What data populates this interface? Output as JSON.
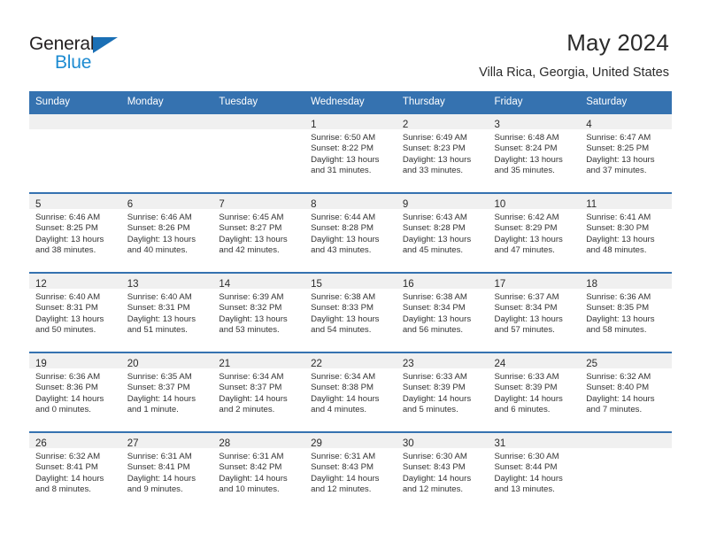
{
  "brand": {
    "name_top": "General",
    "name_bottom": "Blue",
    "triangle_color": "#1a6fb5",
    "blue_text_color": "#1d8bd1"
  },
  "header": {
    "title": "May 2024",
    "subtitle": "Villa Rica, Georgia, United States",
    "header_bg_color": "#3572b0",
    "header_text_color": "#ffffff",
    "daynum_strip_color": "#f0f0f0"
  },
  "weekday_headers": [
    "Sunday",
    "Monday",
    "Tuesday",
    "Wednesday",
    "Thursday",
    "Friday",
    "Saturday"
  ],
  "weeks": [
    [
      {
        "day": "",
        "sunrise": "",
        "sunset": "",
        "daylight_line1": "",
        "daylight_line2": ""
      },
      {
        "day": "",
        "sunrise": "",
        "sunset": "",
        "daylight_line1": "",
        "daylight_line2": ""
      },
      {
        "day": "",
        "sunrise": "",
        "sunset": "",
        "daylight_line1": "",
        "daylight_line2": ""
      },
      {
        "day": "1",
        "sunrise": "Sunrise: 6:50 AM",
        "sunset": "Sunset: 8:22 PM",
        "daylight_line1": "Daylight: 13 hours",
        "daylight_line2": "and 31 minutes."
      },
      {
        "day": "2",
        "sunrise": "Sunrise: 6:49 AM",
        "sunset": "Sunset: 8:23 PM",
        "daylight_line1": "Daylight: 13 hours",
        "daylight_line2": "and 33 minutes."
      },
      {
        "day": "3",
        "sunrise": "Sunrise: 6:48 AM",
        "sunset": "Sunset: 8:24 PM",
        "daylight_line1": "Daylight: 13 hours",
        "daylight_line2": "and 35 minutes."
      },
      {
        "day": "4",
        "sunrise": "Sunrise: 6:47 AM",
        "sunset": "Sunset: 8:25 PM",
        "daylight_line1": "Daylight: 13 hours",
        "daylight_line2": "and 37 minutes."
      }
    ],
    [
      {
        "day": "5",
        "sunrise": "Sunrise: 6:46 AM",
        "sunset": "Sunset: 8:25 PM",
        "daylight_line1": "Daylight: 13 hours",
        "daylight_line2": "and 38 minutes."
      },
      {
        "day": "6",
        "sunrise": "Sunrise: 6:46 AM",
        "sunset": "Sunset: 8:26 PM",
        "daylight_line1": "Daylight: 13 hours",
        "daylight_line2": "and 40 minutes."
      },
      {
        "day": "7",
        "sunrise": "Sunrise: 6:45 AM",
        "sunset": "Sunset: 8:27 PM",
        "daylight_line1": "Daylight: 13 hours",
        "daylight_line2": "and 42 minutes."
      },
      {
        "day": "8",
        "sunrise": "Sunrise: 6:44 AM",
        "sunset": "Sunset: 8:28 PM",
        "daylight_line1": "Daylight: 13 hours",
        "daylight_line2": "and 43 minutes."
      },
      {
        "day": "9",
        "sunrise": "Sunrise: 6:43 AM",
        "sunset": "Sunset: 8:28 PM",
        "daylight_line1": "Daylight: 13 hours",
        "daylight_line2": "and 45 minutes."
      },
      {
        "day": "10",
        "sunrise": "Sunrise: 6:42 AM",
        "sunset": "Sunset: 8:29 PM",
        "daylight_line1": "Daylight: 13 hours",
        "daylight_line2": "and 47 minutes."
      },
      {
        "day": "11",
        "sunrise": "Sunrise: 6:41 AM",
        "sunset": "Sunset: 8:30 PM",
        "daylight_line1": "Daylight: 13 hours",
        "daylight_line2": "and 48 minutes."
      }
    ],
    [
      {
        "day": "12",
        "sunrise": "Sunrise: 6:40 AM",
        "sunset": "Sunset: 8:31 PM",
        "daylight_line1": "Daylight: 13 hours",
        "daylight_line2": "and 50 minutes."
      },
      {
        "day": "13",
        "sunrise": "Sunrise: 6:40 AM",
        "sunset": "Sunset: 8:31 PM",
        "daylight_line1": "Daylight: 13 hours",
        "daylight_line2": "and 51 minutes."
      },
      {
        "day": "14",
        "sunrise": "Sunrise: 6:39 AM",
        "sunset": "Sunset: 8:32 PM",
        "daylight_line1": "Daylight: 13 hours",
        "daylight_line2": "and 53 minutes."
      },
      {
        "day": "15",
        "sunrise": "Sunrise: 6:38 AM",
        "sunset": "Sunset: 8:33 PM",
        "daylight_line1": "Daylight: 13 hours",
        "daylight_line2": "and 54 minutes."
      },
      {
        "day": "16",
        "sunrise": "Sunrise: 6:38 AM",
        "sunset": "Sunset: 8:34 PM",
        "daylight_line1": "Daylight: 13 hours",
        "daylight_line2": "and 56 minutes."
      },
      {
        "day": "17",
        "sunrise": "Sunrise: 6:37 AM",
        "sunset": "Sunset: 8:34 PM",
        "daylight_line1": "Daylight: 13 hours",
        "daylight_line2": "and 57 minutes."
      },
      {
        "day": "18",
        "sunrise": "Sunrise: 6:36 AM",
        "sunset": "Sunset: 8:35 PM",
        "daylight_line1": "Daylight: 13 hours",
        "daylight_line2": "and 58 minutes."
      }
    ],
    [
      {
        "day": "19",
        "sunrise": "Sunrise: 6:36 AM",
        "sunset": "Sunset: 8:36 PM",
        "daylight_line1": "Daylight: 14 hours",
        "daylight_line2": "and 0 minutes."
      },
      {
        "day": "20",
        "sunrise": "Sunrise: 6:35 AM",
        "sunset": "Sunset: 8:37 PM",
        "daylight_line1": "Daylight: 14 hours",
        "daylight_line2": "and 1 minute."
      },
      {
        "day": "21",
        "sunrise": "Sunrise: 6:34 AM",
        "sunset": "Sunset: 8:37 PM",
        "daylight_line1": "Daylight: 14 hours",
        "daylight_line2": "and 2 minutes."
      },
      {
        "day": "22",
        "sunrise": "Sunrise: 6:34 AM",
        "sunset": "Sunset: 8:38 PM",
        "daylight_line1": "Daylight: 14 hours",
        "daylight_line2": "and 4 minutes."
      },
      {
        "day": "23",
        "sunrise": "Sunrise: 6:33 AM",
        "sunset": "Sunset: 8:39 PM",
        "daylight_line1": "Daylight: 14 hours",
        "daylight_line2": "and 5 minutes."
      },
      {
        "day": "24",
        "sunrise": "Sunrise: 6:33 AM",
        "sunset": "Sunset: 8:39 PM",
        "daylight_line1": "Daylight: 14 hours",
        "daylight_line2": "and 6 minutes."
      },
      {
        "day": "25",
        "sunrise": "Sunrise: 6:32 AM",
        "sunset": "Sunset: 8:40 PM",
        "daylight_line1": "Daylight: 14 hours",
        "daylight_line2": "and 7 minutes."
      }
    ],
    [
      {
        "day": "26",
        "sunrise": "Sunrise: 6:32 AM",
        "sunset": "Sunset: 8:41 PM",
        "daylight_line1": "Daylight: 14 hours",
        "daylight_line2": "and 8 minutes."
      },
      {
        "day": "27",
        "sunrise": "Sunrise: 6:31 AM",
        "sunset": "Sunset: 8:41 PM",
        "daylight_line1": "Daylight: 14 hours",
        "daylight_line2": "and 9 minutes."
      },
      {
        "day": "28",
        "sunrise": "Sunrise: 6:31 AM",
        "sunset": "Sunset: 8:42 PM",
        "daylight_line1": "Daylight: 14 hours",
        "daylight_line2": "and 10 minutes."
      },
      {
        "day": "29",
        "sunrise": "Sunrise: 6:31 AM",
        "sunset": "Sunset: 8:43 PM",
        "daylight_line1": "Daylight: 14 hours",
        "daylight_line2": "and 12 minutes."
      },
      {
        "day": "30",
        "sunrise": "Sunrise: 6:30 AM",
        "sunset": "Sunset: 8:43 PM",
        "daylight_line1": "Daylight: 14 hours",
        "daylight_line2": "and 12 minutes."
      },
      {
        "day": "31",
        "sunrise": "Sunrise: 6:30 AM",
        "sunset": "Sunset: 8:44 PM",
        "daylight_line1": "Daylight: 14 hours",
        "daylight_line2": "and 13 minutes."
      },
      {
        "day": "",
        "sunrise": "",
        "sunset": "",
        "daylight_line1": "",
        "daylight_line2": ""
      }
    ]
  ]
}
